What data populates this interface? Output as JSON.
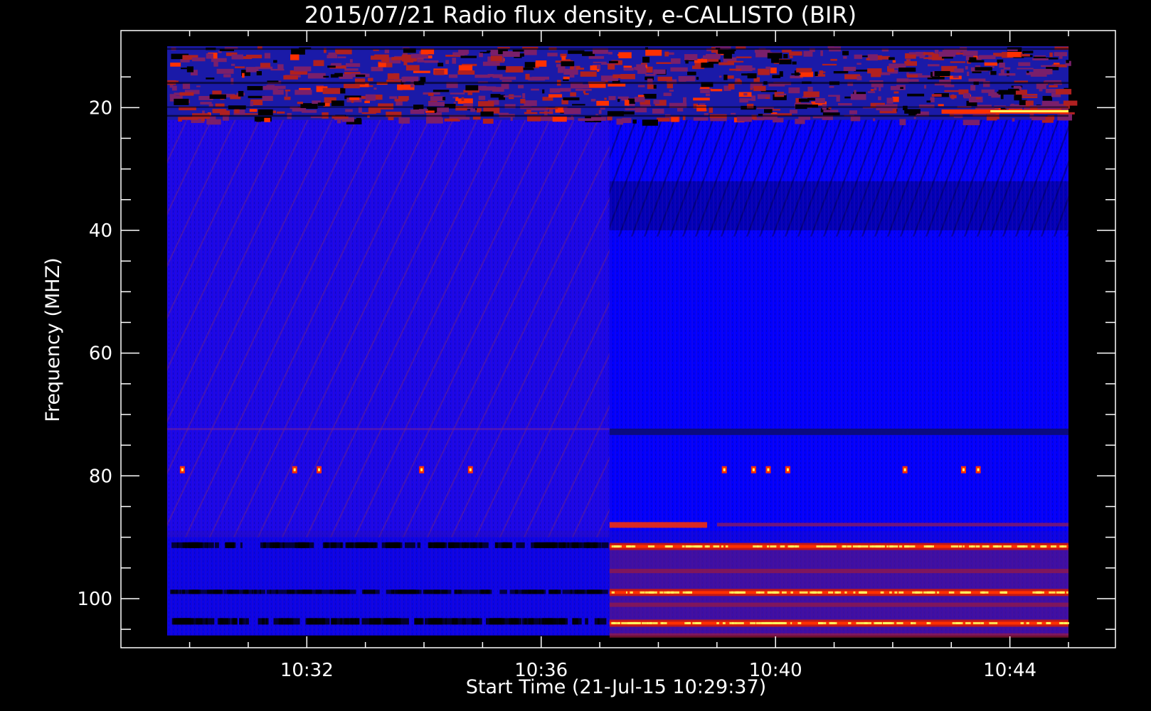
{
  "chart_data": {
    "type": "heatmap",
    "title": "2015/07/21  Radio flux density, e-CALLISTO (BIR)",
    "xlabel": "Start Time (21-Jul-15 10:29:37)",
    "ylabel": "Frequency (MHZ)",
    "x_range_minutes": [
      "10:29:37",
      "10:45:00"
    ],
    "ylim": [
      108,
      10
    ],
    "y_inverted": true,
    "data_frequency_range": [
      10,
      106
    ],
    "x_ticks": [
      "10:32",
      "10:36",
      "10:40",
      "10:44"
    ],
    "y_ticks": [
      20,
      40,
      60,
      80,
      100
    ],
    "grid": false,
    "colors": {
      "background": "#000000",
      "low": "#0000ff",
      "mid": "#7a1f6b",
      "high": "#ff3000",
      "peak": "#ffff60"
    },
    "features": [
      {
        "label": "noise band",
        "freq_range": [
          10,
          22
        ],
        "time_range": [
          "10:29:37",
          "10:45:00"
        ]
      },
      {
        "label": "spike channel",
        "freq": 79,
        "times": [
          "10:29:50",
          "10:31:45",
          "10:32:10",
          "10:33:55",
          "10:34:45",
          "10:39:05",
          "10:39:35",
          "10:39:50",
          "10:40:10",
          "10:42:10",
          "10:43:10",
          "10:43:25"
        ]
      },
      {
        "label": "interference line",
        "freq": 91.5,
        "time_range": [
          "10:37:10",
          "10:45:00"
        ]
      },
      {
        "label": "interference line",
        "freq": 99,
        "time_range": [
          "10:37:10",
          "10:45:00"
        ]
      },
      {
        "label": "interference line",
        "freq": 104,
        "time_range": [
          "10:37:10",
          "10:45:00"
        ]
      }
    ]
  }
}
